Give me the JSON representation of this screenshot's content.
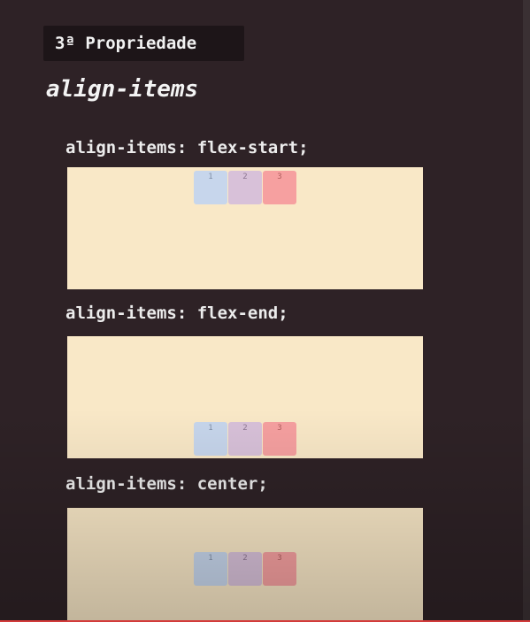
{
  "badge": {
    "label": "3ª Propriedade"
  },
  "heading": "align-items",
  "examples": [
    {
      "label": "align-items: flex-start;",
      "items": [
        "1",
        "2",
        "3"
      ]
    },
    {
      "label": "align-items: flex-end;",
      "items": [
        "1",
        "2",
        "3"
      ]
    },
    {
      "label": "align-items: center;",
      "items": [
        "1",
        "2",
        "3"
      ]
    }
  ],
  "colors": {
    "background": "#2e2226",
    "badge_bg": "#1d1518",
    "container_bg": "#f9e8c7",
    "item1": "#c7d6ec",
    "item2": "#d8c1d9",
    "item3": "#f6a0a0",
    "progress_bar": "#d33b3b"
  }
}
